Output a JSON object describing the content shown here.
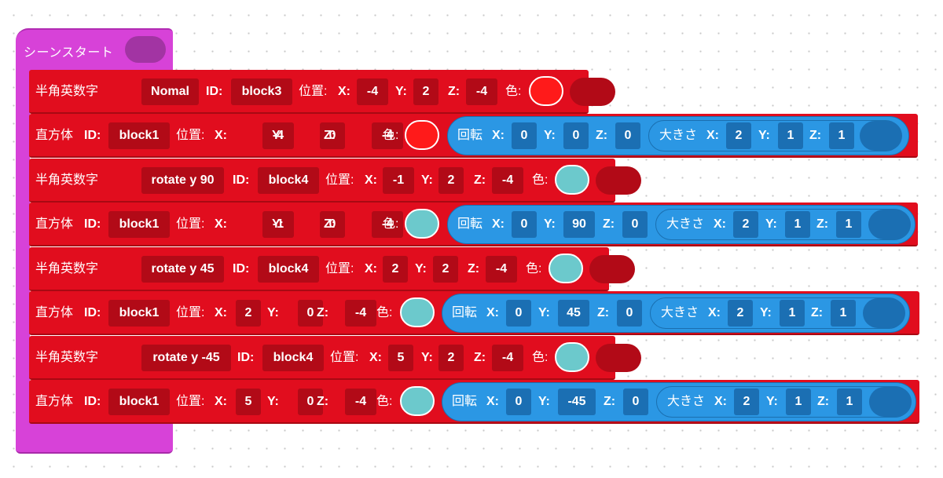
{
  "hat": {
    "label": "シーンスタート"
  },
  "labels": {
    "text_block": "半角英数字",
    "box_block": "直方体",
    "id": "ID:",
    "position": "位置:",
    "x": "X:",
    "y": "Y:",
    "z": "Z:",
    "color": "色:",
    "rotation": "回転",
    "size": "大きさ"
  },
  "colors": {
    "red": "#ff1a1a",
    "teal": "#6cc9cc"
  },
  "rows": [
    {
      "type": "text",
      "text": "Nomal",
      "id": "block3",
      "x": "-4",
      "y": "2",
      "z": "-4",
      "color": "red"
    },
    {
      "type": "box",
      "id": "block1",
      "x": "-4",
      "y": "0",
      "z": "-4",
      "color": "red",
      "rot_x": "0",
      "rot_y": "0",
      "rot_z": "0",
      "size_x": "2",
      "size_y": "1",
      "size_z": "1"
    },
    {
      "type": "text",
      "text": "rotate y 90",
      "id": "block4",
      "x": "-1",
      "y": "2",
      "z": "-4",
      "color": "teal"
    },
    {
      "type": "box",
      "id": "block1",
      "x": "-1",
      "y": "0",
      "z": "-4",
      "color": "teal",
      "rot_x": "0",
      "rot_y": "90",
      "rot_z": "0",
      "size_x": "2",
      "size_y": "1",
      "size_z": "1"
    },
    {
      "type": "text",
      "text": "rotate y 45",
      "id": "block4",
      "x": "2",
      "y": "2",
      "z": "-4",
      "color": "teal"
    },
    {
      "type": "box",
      "id": "block1",
      "x": "2",
      "y": "0",
      "z": "-4",
      "color": "teal",
      "rot_x": "0",
      "rot_y": "45",
      "rot_z": "0",
      "size_x": "2",
      "size_y": "1",
      "size_z": "1"
    },
    {
      "type": "text",
      "text": "rotate y -45",
      "id": "block4",
      "x": "5",
      "y": "2",
      "z": "-4",
      "color": "teal"
    },
    {
      "type": "box",
      "id": "block1",
      "x": "5",
      "y": "0",
      "z": "-4",
      "color": "teal",
      "rot_x": "0",
      "rot_y": "-45",
      "rot_z": "0",
      "size_x": "2",
      "size_y": "1",
      "size_z": "1"
    }
  ]
}
